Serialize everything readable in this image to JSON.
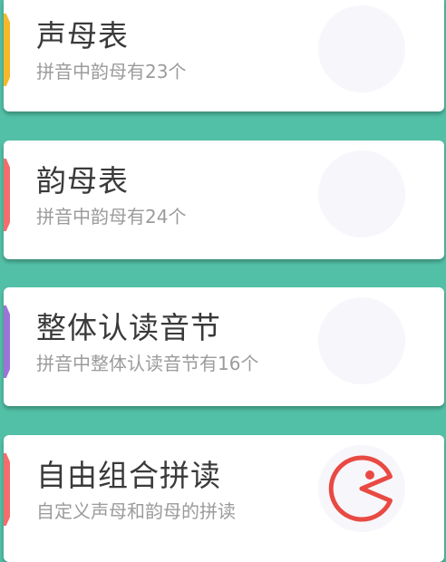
{
  "cards": [
    {
      "title": "声母表",
      "subtitle": "拼音中韵母有23个",
      "accent_color": "#f6b82a"
    },
    {
      "title": "韵母表",
      "subtitle": "拼音中韵母有24个",
      "accent_color": "#f46d6d"
    },
    {
      "title": "整体认读音节",
      "subtitle": "拼音中整体认读音节有16个",
      "accent_color": "#9b74d8"
    },
    {
      "title": "自由组合拼读",
      "subtitle": "自定义声母和韵母的拼读",
      "accent_color": "#f46d6d",
      "icon": "pacman-icon",
      "icon_color": "#e84a43"
    }
  ]
}
